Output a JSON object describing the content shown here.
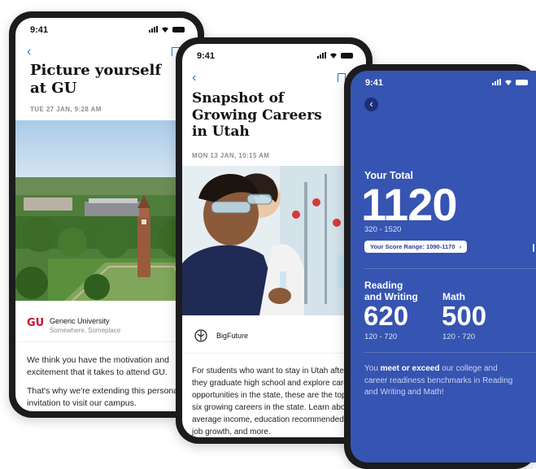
{
  "phone1": {
    "time": "9:41",
    "title_line1": "Picture yourself",
    "title_line2": "at GU",
    "date": "TUE 27 JAN, 9:28 AM",
    "source_name": "Generic University",
    "source_location": "Somewhere, Someplace",
    "logo_text": "GU",
    "body_p1": "We think you have the motivation and excitement that it takes to attend GU.",
    "body_p2": "That's why we're extending this personal invitation to visit our campus."
  },
  "phone2": {
    "time": "9:41",
    "title_line1": "Snapshot of",
    "title_line2": "Growing Careers",
    "title_line3": "in Utah",
    "date": "MON 13 JAN, 10:15 AM",
    "source_name": "BigFuture",
    "body_lines": [
      "For students who want to stay in Utah after",
      "they graduate high school and explore care",
      "opportunities in the state, these are the top",
      "six growing careers in the state. Learn abou",
      "average income, education recommended,",
      "job growth, and more."
    ]
  },
  "phone3": {
    "time": "9:41",
    "total_label": "Your Total",
    "total_score": "1120",
    "total_range": "320 - 1520",
    "score_range_pill": "Your Score Range: 1090-1170",
    "rw_label_line1": "Reading",
    "rw_label_line2": "and Writing",
    "rw_score": "620",
    "rw_range": "120 - 720",
    "math_label": "Math",
    "math_score": "500",
    "math_range": "120 - 720",
    "msg_1": "You ",
    "msg_bold": "meet or exceed",
    "msg_2": " our college and career readiness benchmarks in Reading and Writing and Math!"
  },
  "colors": {
    "accent_blue": "#2f6fd8",
    "score_panel_blue": "#3654b1",
    "gu_red": "#c8102e"
  }
}
